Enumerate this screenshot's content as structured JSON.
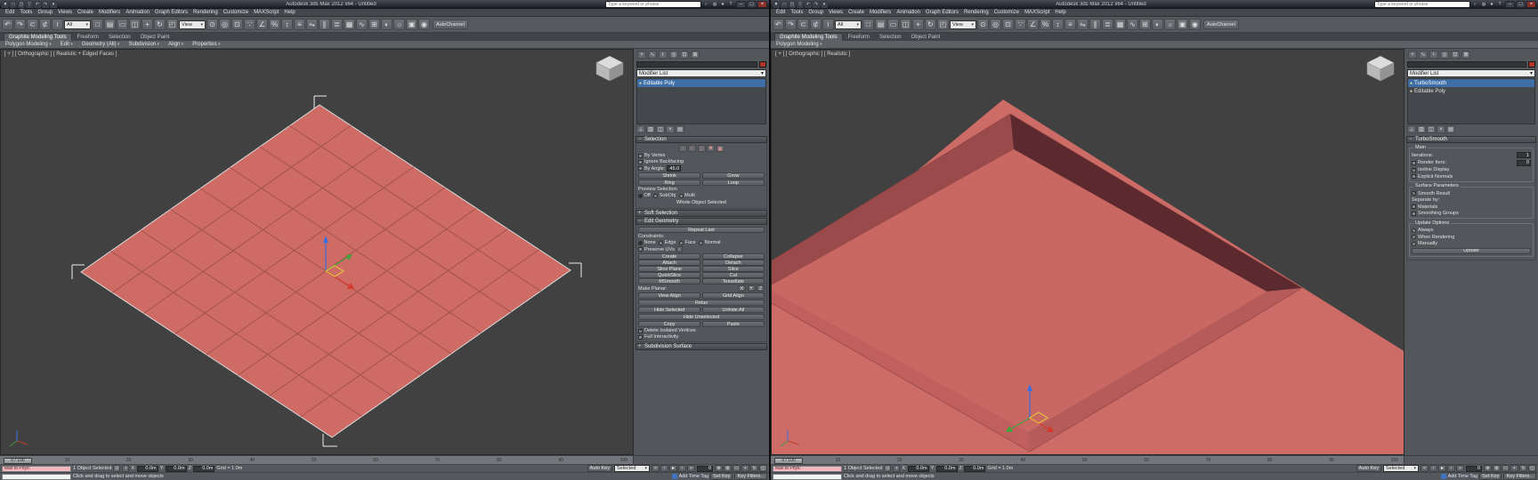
{
  "app": {
    "title": "Autodesk 3ds Max 2012 x64  - Untitled",
    "search_placeholder": "Type a keyword or phrase",
    "menu_items": [
      "Edit",
      "Tools",
      "Group",
      "Views",
      "Create",
      "Modifiers",
      "Animation",
      "Graph Editors",
      "Rendering",
      "Customize",
      "MAXScript",
      "Help"
    ],
    "quick_access_icons": [
      {
        "name": "application-menu-icon",
        "glyph": "▼"
      },
      {
        "name": "new-scene-icon",
        "glyph": "□"
      },
      {
        "name": "open-file-icon",
        "glyph": "◳"
      },
      {
        "name": "save-file-icon",
        "glyph": "▽"
      },
      {
        "name": "undo-icon",
        "glyph": "↶"
      },
      {
        "name": "redo-icon",
        "glyph": "↷"
      },
      {
        "name": "workspace-dropdown-icon",
        "glyph": "▾"
      }
    ],
    "infocenter": {
      "search_icon": "○",
      "icons": [
        {
          "name": "communication-center-icon",
          "glyph": "◍"
        },
        {
          "name": "favorites-icon",
          "glyph": "★"
        },
        {
          "name": "help-icon",
          "glyph": "?"
        }
      ]
    },
    "window_buttons": [
      {
        "name": "minimize-button",
        "glyph": "–"
      },
      {
        "name": "maximize-button",
        "glyph": "□"
      },
      {
        "name": "close-button",
        "glyph": "×"
      }
    ],
    "toolbar": {
      "icons_a": [
        {
          "name": "undo-icon",
          "glyph": "↶"
        },
        {
          "name": "redo-icon",
          "glyph": "↷"
        },
        {
          "name": "select-and-link-icon",
          "glyph": "⊂"
        },
        {
          "name": "unlink-selection-icon",
          "glyph": "⊄"
        },
        {
          "name": "bind-to-space-warp-icon",
          "glyph": "≀"
        }
      ],
      "filter_dropdown": "All",
      "icons_b": [
        {
          "name": "select-object-icon",
          "glyph": "□"
        },
        {
          "name": "select-by-name-icon",
          "glyph": "▤"
        },
        {
          "name": "rectangular-selection-region-icon",
          "glyph": "▭"
        },
        {
          "name": "window-crossing-icon",
          "glyph": "◫"
        }
      ],
      "icons_c": [
        {
          "name": "select-and-move-icon",
          "glyph": "+"
        },
        {
          "name": "select-and-rotate-icon",
          "glyph": "↻"
        },
        {
          "name": "select-and-scale-icon",
          "glyph": "◰"
        }
      ],
      "coord_dropdown": "View",
      "icons_d": [
        {
          "name": "use-pivot-center-icon",
          "glyph": "⊙"
        },
        {
          "name": "select-and-manipulate-icon",
          "glyph": "◎"
        },
        {
          "name": "keyboard-shortcut-override-icon",
          "glyph": "⊡"
        },
        {
          "name": "snaps-toggle-icon",
          "glyph": "∵"
        },
        {
          "name": "angle-snap-toggle-icon",
          "glyph": "∠"
        },
        {
          "name": "percent-snap-toggle-icon",
          "glyph": "%"
        },
        {
          "name": "spinner-snap-toggle-icon",
          "glyph": "↕"
        },
        {
          "name": "edit-named-selection-sets-icon",
          "glyph": "≡"
        },
        {
          "name": "mirror-icon",
          "glyph": "⇋"
        },
        {
          "name": "align-icon",
          "glyph": "∥"
        },
        {
          "name": "layer-manager-icon",
          "glyph": "≣"
        },
        {
          "name": "graphite-ribbon-toggle-icon",
          "glyph": "▦"
        },
        {
          "name": "curve-editor-icon",
          "glyph": "∿"
        },
        {
          "name": "schematic-view-icon",
          "glyph": "⊞"
        },
        {
          "name": "material-editor-icon",
          "glyph": "◐"
        },
        {
          "name": "render-setup-icon",
          "glyph": "☼"
        },
        {
          "name": "rendered-frame-window-icon",
          "glyph": "▣"
        },
        {
          "name": "render-production-icon",
          "glyph": "◉"
        }
      ],
      "autochannel_label": "AutoChannel"
    },
    "ribbon_tabs": [
      "Graphite Modeling Tools",
      "Freeform",
      "Selection",
      "Object Paint"
    ]
  },
  "panel_shared": {
    "tab_icons": [
      {
        "name": "create-tab-icon",
        "glyph": "+"
      },
      {
        "name": "modify-tab-icon",
        "glyph": "∿"
      },
      {
        "name": "hierarchy-tab-icon",
        "glyph": "⊦"
      },
      {
        "name": "motion-tab-icon",
        "glyph": "◎"
      },
      {
        "name": "display-tab-icon",
        "glyph": "⊡"
      },
      {
        "name": "utilities-tab-icon",
        "glyph": "⊠"
      }
    ],
    "modifier_list_label": "Modifier List",
    "stack_bulb_glyph": "●",
    "collapse_sign": "−",
    "expand_sign": "+",
    "stack_buttons": [
      {
        "name": "pin-stack-icon",
        "glyph": "⊥"
      },
      {
        "name": "show-end-result-icon",
        "glyph": "▥"
      },
      {
        "name": "make-unique-icon",
        "glyph": "◫"
      },
      {
        "name": "remove-modifier-icon",
        "glyph": "×"
      },
      {
        "name": "configure-modifier-sets-icon",
        "glyph": "▤"
      }
    ]
  },
  "left": {
    "ribbon_sections": [
      "Polygon Modeling",
      "Edit",
      "Geometry (All)",
      "Subdivision",
      "Align",
      "Properties"
    ],
    "viewport_label": "[ + ] [ Orthographic ] [ Realistic + Edged Faces ]",
    "panel": {
      "stack_items": [
        {
          "label": "Editable Poly",
          "cls": "selected"
        }
      ],
      "selection": {
        "title": "Selection",
        "subobject_icons": [
          {
            "name": "vertex-subobject-icon",
            "glyph": "∴"
          },
          {
            "name": "edge-subobject-icon",
            "glyph": "∕"
          },
          {
            "name": "border-subobject-icon",
            "glyph": "◇"
          },
          {
            "name": "polygon-subobject-icon",
            "glyph": "■"
          },
          {
            "name": "element-subobject-icon",
            "glyph": "▣"
          }
        ],
        "by_vertex": "By Vertex",
        "ignore_backfacing": "Ignore Backfacing",
        "by_angle": "By Angle:",
        "angle_value": "45.0",
        "shrink": "Shrink",
        "grow": "Grow",
        "ring": "Ring",
        "loop": "Loop",
        "preview_label": "Preview Selection",
        "preview_options": [
          "Off",
          "SubObj",
          "Multi"
        ],
        "status_text": "Whole Object Selected"
      },
      "soft_selection_title": "Soft Selection",
      "edit_geometry": {
        "title": "Edit Geometry",
        "repeat_last": "Repeat Last",
        "constraints_label": "Constraints:",
        "constraints": [
          "None",
          "Edge",
          "Face",
          "Normal"
        ],
        "preserve_uvs": "Preserve UVs",
        "pairs": [
          [
            "Create",
            "Collapse"
          ],
          [
            "Attach",
            "Detach"
          ],
          [
            "Slice Plane",
            "Slice"
          ],
          [
            "QuickSlice",
            "Cut"
          ],
          [
            "MSmooth",
            "Tessellate"
          ]
        ],
        "make_planar": "Make Planar:",
        "axes": [
          "X",
          "Y",
          "Z"
        ],
        "pairs2": [
          [
            "View Align",
            "Grid Align"
          ]
        ],
        "relax": "Relax",
        "pairs3": [
          [
            "Hide Selected",
            "Unhide All"
          ]
        ],
        "hide_unselected": "Hide Unselected",
        "pairs4": [
          [
            "Copy",
            "Paste"
          ]
        ],
        "delete_isolated": "Delete Isolated Vertices",
        "full_interactivity": "Full Interactivity"
      },
      "subdivision_surface_title": "Subdivision Surface"
    }
  },
  "right": {
    "ribbon_sections": [
      "Polygon Modeling"
    ],
    "viewport_label": "[ + ] [ Orthographic ] [ Realistic ]",
    "panel": {
      "stack_items": [
        {
          "label": "TurboSmooth",
          "cls": "selected"
        },
        {
          "label": "Editable Poly",
          "cls": ""
        }
      ],
      "turbosmooth": {
        "title": "TurboSmooth",
        "main_group": "Main",
        "iterations_label": "Iterations:",
        "iterations_value": "1",
        "render_iters_label": "Render Iters:",
        "render_iters_value": "0",
        "isoline_display": "Isoline Display",
        "explicit_normals": "Explicit Normals",
        "surface_group": "Surface Parameters",
        "smooth_result": "Smooth Result",
        "separate_by_label": "Separate by:",
        "materials": "Materials",
        "smoothing_groups": "Smoothing Groups",
        "update_group": "Update Options",
        "update_options": [
          "Always",
          "When Rendering",
          "Manually"
        ],
        "update_button": "Update"
      }
    }
  },
  "timeline": {
    "slider_label": "0 / 100",
    "ticks": [
      "0",
      "10",
      "20",
      "30",
      "40",
      "50",
      "60",
      "70",
      "80",
      "90",
      "100"
    ]
  },
  "statusbar": {
    "listener_text": "Max to Phys:",
    "selection_status": "1 Object Selected",
    "lock_glyph": "⊡",
    "absolute_glyph": "+",
    "x_label": "X:",
    "y_label": "Y:",
    "z_label": "Z:",
    "x_value": "0.0m",
    "y_value": "0.0m",
    "z_value": "0.0m",
    "grid_label": "Grid = 1.0m",
    "prompt": "Click and drag to select and move objects",
    "add_time_tag": "Add Time Tag",
    "auto_key": "Auto Key",
    "set_key": "Set Key",
    "selected_dropdown": "Selected",
    "key_filters": "Key Filters...",
    "frame_value": "0",
    "transport_icons": [
      {
        "name": "go-to-start-icon",
        "glyph": "«"
      },
      {
        "name": "previous-frame-icon",
        "glyph": "‹"
      },
      {
        "name": "play-animation-icon",
        "glyph": "►"
      },
      {
        "name": "next-frame-icon",
        "glyph": "›"
      },
      {
        "name": "go-to-end-icon",
        "glyph": "»"
      }
    ],
    "nav_icons": [
      {
        "name": "zoom-icon",
        "glyph": "⊕"
      },
      {
        "name": "zoom-extents-icon",
        "glyph": "⊞"
      },
      {
        "name": "zoom-region-icon",
        "glyph": "▭"
      },
      {
        "name": "pan-icon",
        "glyph": "+"
      },
      {
        "name": "orbit-icon",
        "glyph": "↻"
      },
      {
        "name": "maximize-viewport-toggle-icon",
        "glyph": "◱"
      }
    ]
  },
  "colors": {
    "plane_fill": "#ce6b65",
    "plane_grid": "#a2524e",
    "viewport_bg": "#414141",
    "stack_selected": "#3f6ea6",
    "object_color": "#b5322a"
  }
}
